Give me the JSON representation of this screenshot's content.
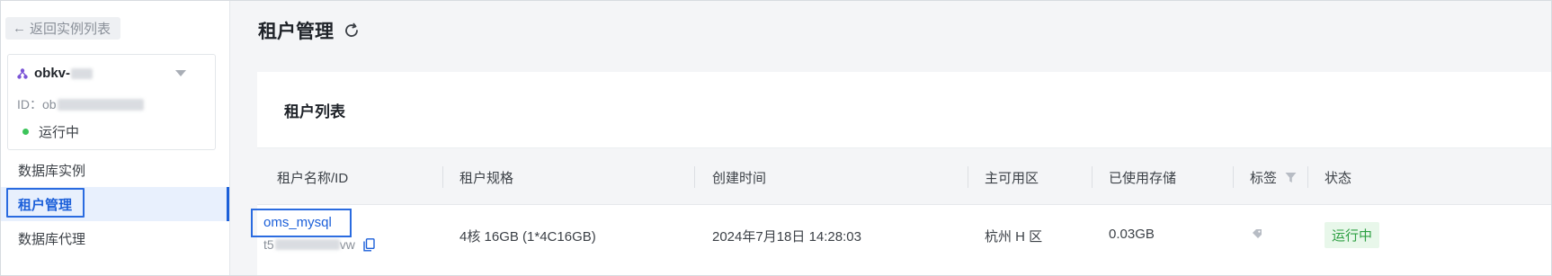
{
  "sidebar": {
    "back_label": "返回实例列表",
    "instance": {
      "name_prefix": "obkv-",
      "id_label": "ID：",
      "id_prefix": "ob",
      "status": "运行中",
      "status_color": "#3cc45a"
    },
    "nav_items": [
      {
        "label": "数据库实例",
        "active": false
      },
      {
        "label": "租户管理",
        "active": true
      },
      {
        "label": "数据库代理",
        "active": false
      }
    ]
  },
  "page": {
    "title": "租户管理",
    "refresh_icon": "refresh-icon"
  },
  "panel": {
    "title": "租户列表",
    "columns": [
      "租户名称/ID",
      "租户规格",
      "创建时间",
      "主可用区",
      "已使用存储",
      "标签",
      "状态"
    ],
    "rows": [
      {
        "tenant_name": "oms_mysql",
        "tenant_id_prefix": "t5",
        "tenant_id_suffix": "vw",
        "spec": "4核 16GB (1*4C16GB)",
        "created": "2024年7月18日 14:28:03",
        "zone": "杭州 H 区",
        "storage": "0.03GB",
        "tag_icon": "tag-icon",
        "status": "运行中"
      }
    ]
  },
  "colors": {
    "accent": "#1b5fd9",
    "status_green": "#2ea043",
    "status_bg": "#e8f7ea"
  }
}
